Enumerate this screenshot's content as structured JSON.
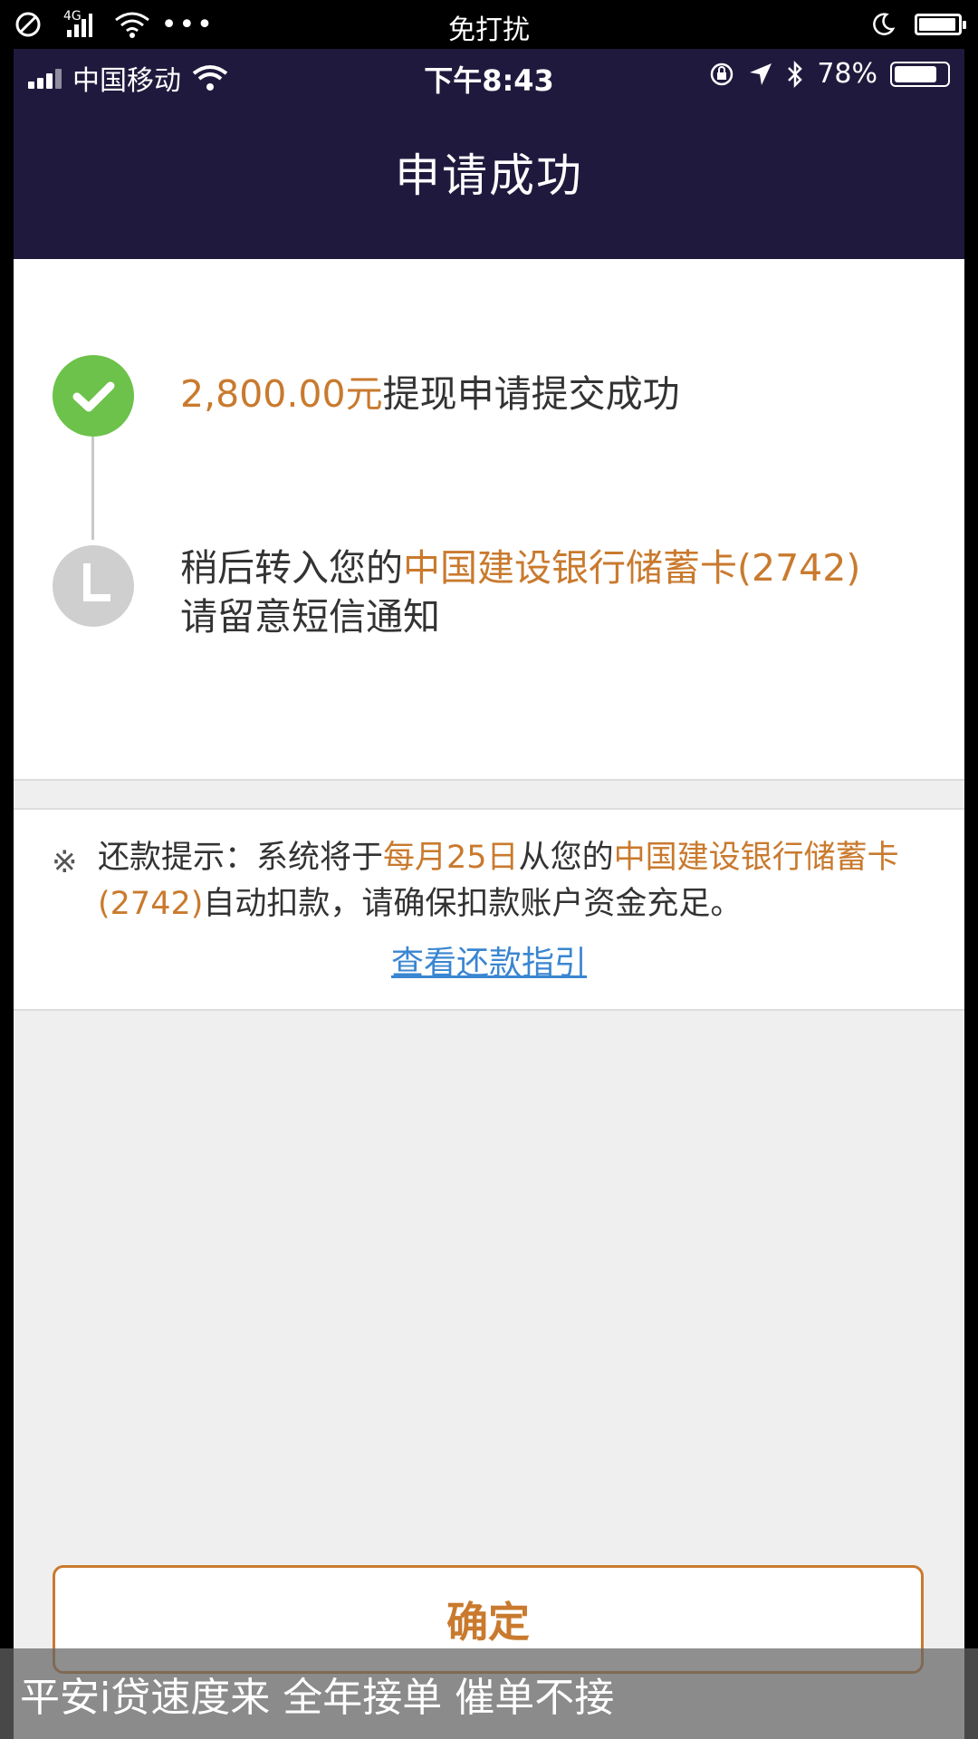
{
  "outer_status": {
    "center_text": "免打扰",
    "network": "4G"
  },
  "ios_status": {
    "carrier": "中国移动",
    "time": "下午8:43",
    "battery": "78%"
  },
  "nav": {
    "title": "申请成功"
  },
  "steps": {
    "step1": {
      "amount": "2,800.00元",
      "text": "提现申请提交成功"
    },
    "step2": {
      "prefix": "稍后转入您的",
      "bank": "中国建设银行储蓄卡(2742)",
      "line2": "请留意短信通知"
    }
  },
  "notice": {
    "mark": "※",
    "p1": "还款提示：系统将于",
    "date": "每月25日",
    "p2": "从您的",
    "bank": "中国建设银行储蓄卡(2742)",
    "p3": "自动扣款，请确保扣款账户资金充足。",
    "link": "查看还款指引"
  },
  "confirm_label": "确定",
  "overlay_text": "平安i贷速度来 全年接单  催单不接",
  "colors": {
    "nav_bg": "#1f1a3d",
    "accent": "#c97a2e",
    "success": "#6cc24a",
    "link": "#3a86d1"
  }
}
